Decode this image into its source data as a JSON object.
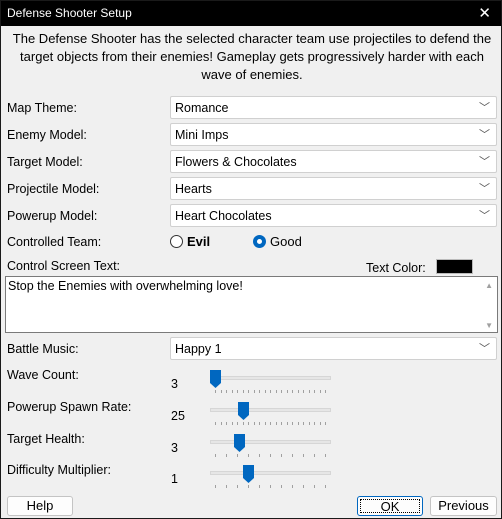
{
  "window": {
    "title": "Defense Shooter Setup",
    "close_icon": "close-icon"
  },
  "description": "The Defense Shooter has the selected character team use projectiles to defend the target objects from their enemies! Gameplay gets progressively harder with each wave of enemies.",
  "fields": {
    "map_theme": {
      "label": "Map Theme:",
      "value": "Romance"
    },
    "enemy_model": {
      "label": "Enemy Model:",
      "value": "Mini Imps"
    },
    "target_model": {
      "label": "Target Model:",
      "value": "Flowers & Chocolates"
    },
    "projectile_model": {
      "label": "Projectile Model:",
      "value": "Hearts"
    },
    "powerup_model": {
      "label": "Powerup Model:",
      "value": "Heart Chocolates"
    },
    "battle_music": {
      "label": "Battle Music:",
      "value": "Happy 1"
    }
  },
  "controlled_team": {
    "label": "Controlled Team:",
    "options": [
      {
        "label": "Evil",
        "selected": false
      },
      {
        "label": "Good",
        "selected": true
      }
    ]
  },
  "control_screen": {
    "label": "Control Screen Text:",
    "text": "Stop the Enemies with overwhelming love!",
    "text_color_label": "Text Color:",
    "text_color": "#000000"
  },
  "sliders": {
    "wave_count": {
      "label": "Wave Count:",
      "value": "3",
      "position": 0.0,
      "ticks": 21
    },
    "powerup_spawn_rate": {
      "label": "Powerup Spawn Rate:",
      "value": "25",
      "position": 0.25,
      "ticks": 21
    },
    "target_health": {
      "label": "Target Health:",
      "value": "3",
      "position": 0.22,
      "ticks": 11
    },
    "difficulty_multiplier": {
      "label": "Difficulty Multiplier:",
      "value": "1",
      "position": 0.3,
      "ticks": 11
    }
  },
  "buttons": {
    "help": "Help",
    "ok": "OK",
    "previous": "Previous"
  },
  "colors": {
    "accent": "#0067c0",
    "titlebar": "#000000"
  }
}
